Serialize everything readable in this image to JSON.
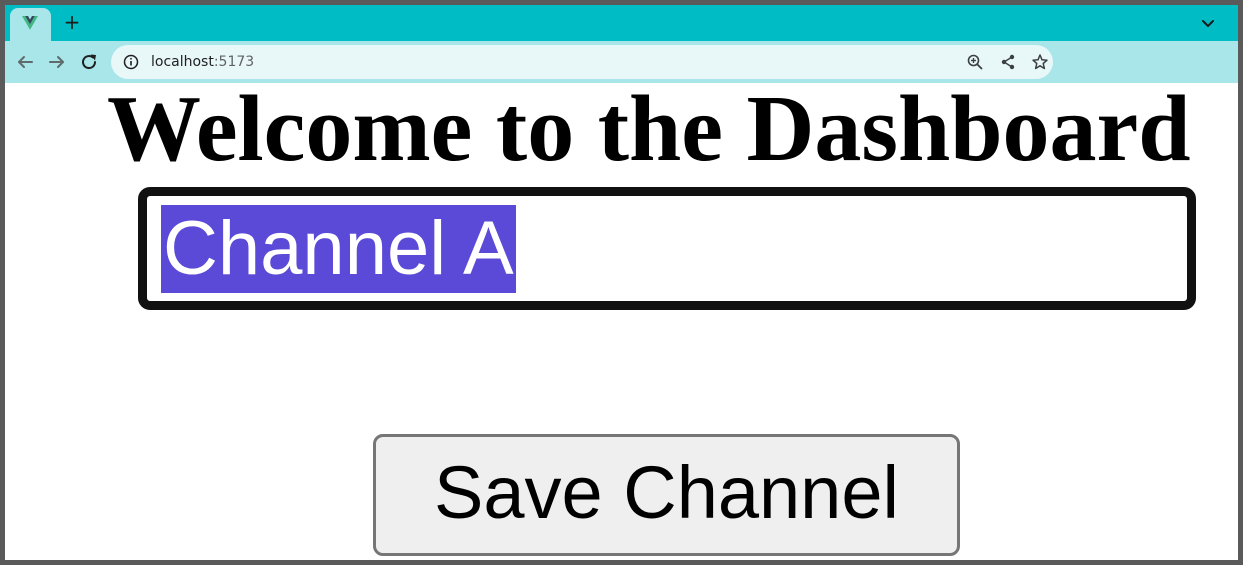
{
  "browser": {
    "tab": {
      "favicon": "vue-logo-icon"
    },
    "new_tab_label": "+",
    "address_bar": {
      "host": "localhost",
      "port": ":5173"
    },
    "icons": {
      "back": "arrow-left-icon",
      "forward": "arrow-right-icon",
      "reload": "reload-icon",
      "site_info": "info-icon",
      "zoom": "zoom-in-icon",
      "share": "share-icon",
      "bookmark": "star-icon",
      "tab_search": "chevron-down-icon"
    },
    "colors": {
      "tabstrip": "#00bcc4",
      "toolbar": "#a8e6ea"
    }
  },
  "page": {
    "title": "Welcome to the Dashboard",
    "channel_input": {
      "value": "Channel A",
      "selected": true,
      "selection_color": "#5b49d8"
    },
    "save_button_label": "Save Channel"
  }
}
